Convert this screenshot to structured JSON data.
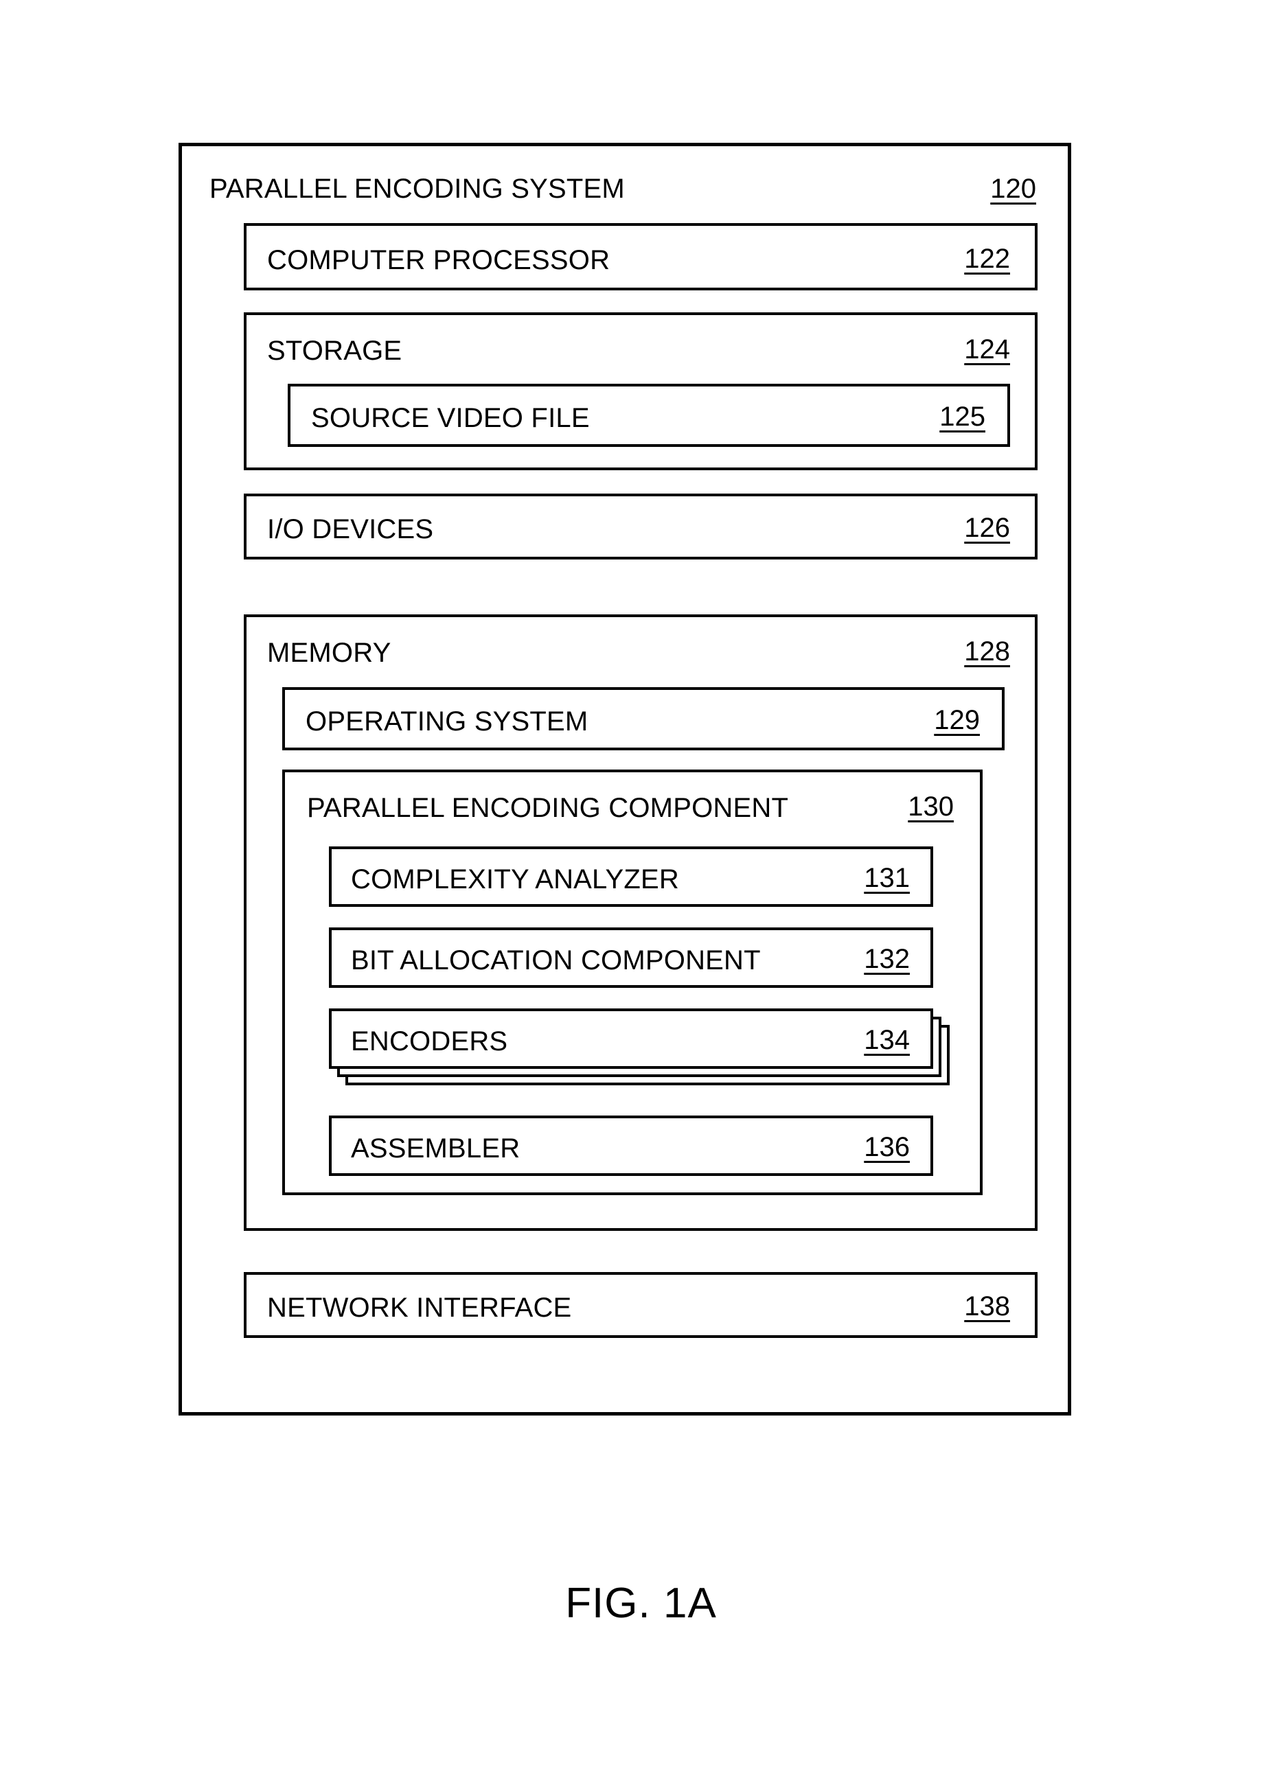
{
  "figure": {
    "caption": "FIG. 1A"
  },
  "diagram": {
    "system": {
      "label": "PARALLEL ENCODING SYSTEM",
      "ref": "120",
      "children": [
        {
          "label": "COMPUTER PROCESSOR",
          "ref": "122"
        },
        {
          "label": "STORAGE",
          "ref": "124"
        },
        {
          "label": "SOURCE VIDEO FILE",
          "ref": "125"
        },
        {
          "label": "I/O DEVICES",
          "ref": "126"
        },
        {
          "label": "MEMORY",
          "ref": "128"
        },
        {
          "label": "OPERATING SYSTEM",
          "ref": "129"
        },
        {
          "label": "PARALLEL ENCODING COMPONENT",
          "ref": "130"
        },
        {
          "label": "COMPLEXITY ANALYZER",
          "ref": "131"
        },
        {
          "label": "BIT ALLOCATION COMPONENT",
          "ref": "132"
        },
        {
          "label": "ENCODERS",
          "ref": "134"
        },
        {
          "label": "ASSEMBLER",
          "ref": "136"
        },
        {
          "label": "NETWORK INTERFACE",
          "ref": "138"
        }
      ]
    }
  }
}
